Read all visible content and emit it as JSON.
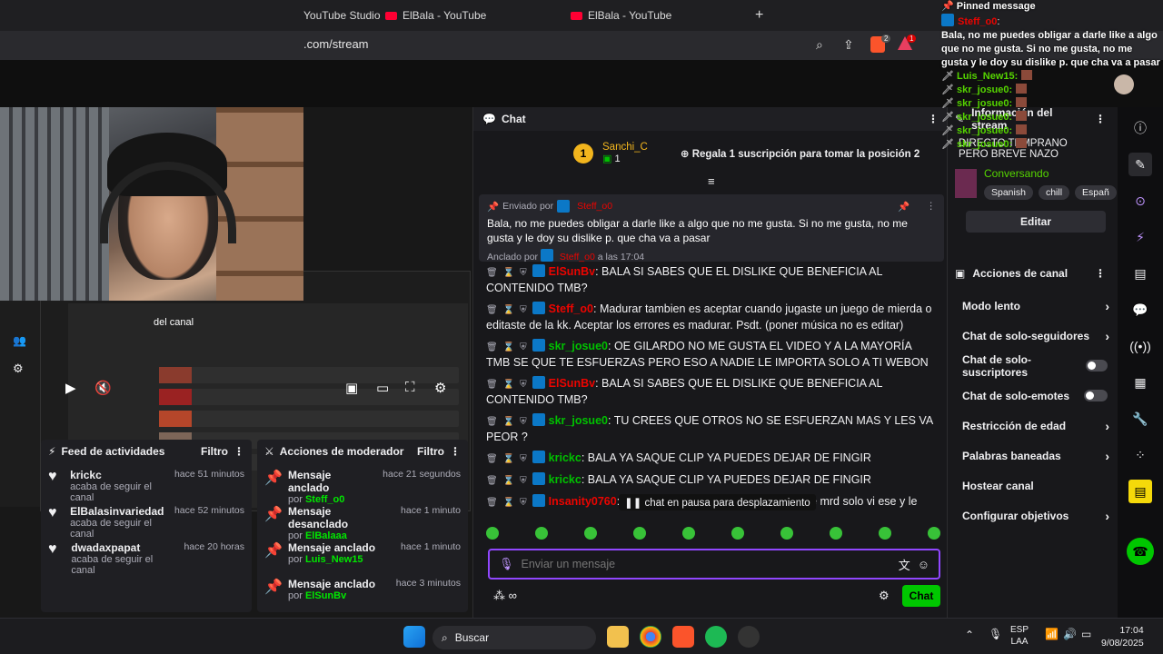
{
  "browser": {
    "tabs": [
      {
        "label": "YouTube Studio"
      },
      {
        "label": "ElBala - YouTube"
      },
      {
        "label": "ElBala - YouTube"
      }
    ],
    "url": ".com/stream",
    "new_tab": "+",
    "ext_badge_1": "2",
    "ext_badge_2": "1"
  },
  "preview": {
    "channel_label": "del canal"
  },
  "feed": {
    "title": "Feed de actividades",
    "filter": "Filtro",
    "items": [
      {
        "user": "krickc",
        "desc": "acaba de seguir el canal",
        "time": "hace 51 minutos"
      },
      {
        "user": "ElBalasinvariedad",
        "desc": "acaba de seguir el canal",
        "time": "hace 52 minutos"
      },
      {
        "user": "dwadaxpapat",
        "desc": "acaba de seguir el canal",
        "time": "hace 20 horas"
      }
    ]
  },
  "mod": {
    "title": "Acciones de moderador",
    "filter": "Filtro",
    "items": [
      {
        "action": "Mensaje anclado",
        "by": "por",
        "user": "Steff_o0",
        "time": "hace 21 segundos"
      },
      {
        "action": "Mensaje desanclado",
        "by": "por",
        "user": "ElBalaaa",
        "time": "hace 1 minuto"
      },
      {
        "action": "Mensaje anclado",
        "by": "por",
        "user": "Luis_New15",
        "time": "hace 1 minuto"
      },
      {
        "action": "Mensaje anclado",
        "by": "por",
        "user": "ElSunBv",
        "time": "hace 3 minutos"
      }
    ]
  },
  "chat": {
    "title": "Chat",
    "leader": {
      "rank": "1",
      "user": "Sanchi_C",
      "count": "1",
      "cta": "Regala 1 suscripción para tomar la posición 2"
    },
    "pinned": {
      "sent_by_label": "Enviado por",
      "sender": "Steff_o0",
      "body": "Bala, no me puedes obligar a darle like a algo que no me gusta. Si no me gusta, no me gusta y le doy su dislike p. que cha va a pasar",
      "anchored_label": "Anclado por",
      "anchored_user": "Steff_o0",
      "anchored_time": "a las 17:04"
    },
    "messages": [
      {
        "user": "ElSunBv",
        "color": "#eb0400",
        "text": "BALA SI SABES QUE EL DISLIKE QUE BENEFICIA AL CONTENIDO TMB?"
      },
      {
        "user": "Steff_o0",
        "color": "#eb0400",
        "text": "Madurar tambien es aceptar cuando jugaste un juego de mierda o editaste de la kk. Aceptar los errores es madurar. Psdt. (poner música no es editar)"
      },
      {
        "user": "skr_josue0",
        "color": "#00c000",
        "text": "OE GILARDO NO ME GUSTA EL VIDEO Y A LA MAYORÍA TMB SE QUE TE ESFUERZAS PERO ESO A NADIE LE IMPORTA SOLO A TI WEBON"
      },
      {
        "user": "ElSunBv",
        "color": "#eb0400",
        "text": "BALA SI SABES QUE EL DISLIKE QUE BENEFICIA AL CONTENIDO TMB?"
      },
      {
        "user": "skr_josue0",
        "color": "#00c000",
        "text": "TU CREES QUE OTROS NO SE ESFUERZAN MAS Y LES VA PEOR ?"
      },
      {
        "user": "krickc",
        "color": "#00c000",
        "text": "BALA YA SAQUE CLIP YA PUEDES DEJAR DE FINGIR"
      },
      {
        "user": "krickc",
        "color": "#00c000",
        "text": "BALA YA SAQUE CLIP YA PUEDES DEJAR DE FINGIR"
      },
      {
        "user": "Insanity0760",
        "color": "#eb0400",
        "text": "bala almenos yo no miro tus videos de mrd solo vi ese y le"
      }
    ],
    "paused": "chat en pausa para desplazamiento",
    "input_placeholder": "Enviar un mensaje",
    "send_label": "Chat",
    "points": "∞"
  },
  "stream_info": {
    "title": "Información del stream",
    "stream_title": "DIRECTO TEMPRANO PERO BREVE   NAZO",
    "category": "Conversando",
    "tags": [
      "Spanish",
      "chill",
      "Españ"
    ],
    "edit": "Editar"
  },
  "channel_actions": {
    "title": "Acciones de canal",
    "items": [
      {
        "label": "Modo lento",
        "kind": "chevron"
      },
      {
        "label": "Chat de solo-seguidores",
        "kind": "chevron"
      },
      {
        "label": "Chat de solo-suscriptores",
        "kind": "toggle"
      },
      {
        "label": "Chat de solo-emotes",
        "kind": "toggle"
      },
      {
        "label": "Restricción de edad",
        "kind": "chevron"
      },
      {
        "label": "Palabras baneadas",
        "kind": "chevron"
      },
      {
        "label": "Hostear canal",
        "kind": "none"
      },
      {
        "label": "Configurar objetivos",
        "kind": "chevron"
      }
    ]
  },
  "overlay": {
    "header": "Pinned message",
    "pin_user": "Steff_o0",
    "pin_text": "Bala, no me puedes obligar a darle like a algo que no me gusta. Si no me gusta, no me gusta y le doy su dislike p. que cha va a pasar",
    "lines": [
      "Luis_New15:",
      "skr_josue0:",
      "skr_josue0:",
      "skr_josue0:",
      "skr_josue0:",
      "skr_josue0:"
    ]
  },
  "taskbar": {
    "search": "Buscar",
    "lang1": "ESP",
    "lang2": "LAA",
    "time": "17:04",
    "date": "9/08/2025"
  }
}
